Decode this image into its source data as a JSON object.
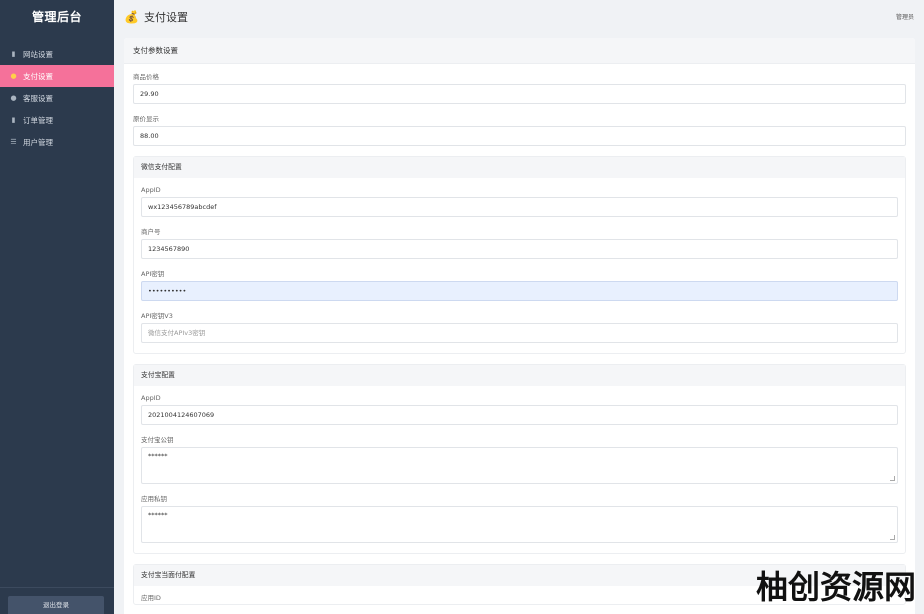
{
  "sidebar": {
    "brand": "管理后台",
    "items": [
      {
        "label": "网站设置",
        "icon": "document-icon"
      },
      {
        "label": "支付设置",
        "icon": "money-bag-icon",
        "active": true
      },
      {
        "label": "客服设置",
        "icon": "user-icon"
      },
      {
        "label": "订单管理",
        "icon": "clipboard-icon"
      },
      {
        "label": "用户管理",
        "icon": "users-icon"
      }
    ],
    "logout": "退出登录"
  },
  "topbar": {
    "title": "支付设置",
    "admin": "管理员"
  },
  "card": {
    "header": "支付参数设置",
    "fields": [
      {
        "label": "商品价格",
        "value": "29.90"
      },
      {
        "label": "原价显示",
        "value": "88.00"
      }
    ],
    "wechat": {
      "header": "微信支付配置",
      "fields": [
        {
          "label": "AppID",
          "value": "wx123456789abcdef"
        },
        {
          "label": "商户号",
          "value": "1234567890"
        },
        {
          "label": "API密钥",
          "value": "••••••••••"
        },
        {
          "label": "API密钥V3",
          "placeholder": "微信支付APIv3密钥"
        }
      ]
    },
    "alipay": {
      "header": "支付宝配置",
      "fields": [
        {
          "label": "AppID",
          "value": "2021004124607069"
        },
        {
          "label": "支付宝公钥",
          "value": "******"
        },
        {
          "label": "应用私钥",
          "value": "******"
        }
      ]
    },
    "alipay_f2f": {
      "header": "支付宝当面付配置",
      "first_label": "应用ID"
    }
  },
  "watermark": "柚创资源网",
  "colors": {
    "sidebar": "#2c3a4d",
    "active": "#f5719a"
  }
}
